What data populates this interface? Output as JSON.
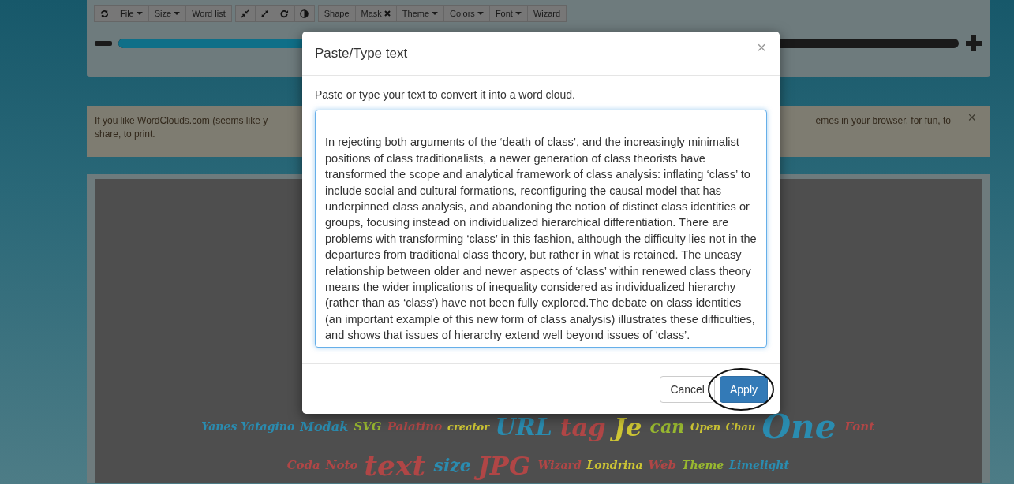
{
  "toolbar": {
    "groups": [
      [
        {
          "kind": "refresh"
        },
        {
          "kind": "dropdown",
          "label": "File"
        },
        {
          "kind": "dropdown",
          "label": "Size"
        },
        {
          "kind": "plain",
          "label": "Word list"
        }
      ],
      [
        {
          "kind": "shrink"
        },
        {
          "kind": "expand"
        },
        {
          "kind": "redo"
        },
        {
          "kind": "contrast"
        }
      ],
      [
        {
          "kind": "plain",
          "label": "Shape"
        },
        {
          "kind": "remove",
          "label": "Mask"
        },
        {
          "kind": "dropdown",
          "label": "Theme"
        },
        {
          "kind": "dropdown",
          "label": "Colors"
        },
        {
          "kind": "dropdown",
          "label": "Font"
        },
        {
          "kind": "plain",
          "label": "Wizard"
        }
      ]
    ],
    "zoom_slider": {
      "level": 0.5
    }
  },
  "banner": {
    "left_lines": [
      "If you like WordClouds.com (seems like y",
      "share, to print."
    ],
    "right_text": "emes in your browser, for fun, to",
    "close": "×"
  },
  "word_cloud": [
    {
      "text": "Yanes Yatagino",
      "color": "#2a8cb0"
    },
    {
      "text": "Modak",
      "color": "#2a8cb0"
    },
    {
      "text": "SVG",
      "color": "#98b830"
    },
    {
      "text": "Palatino",
      "color": "#b04646"
    },
    {
      "text": "creator",
      "color": "#cec634"
    },
    {
      "text": "URL",
      "color": "#2a8cb0"
    },
    {
      "text": "tag",
      "color": "#b04646"
    },
    {
      "text": "Je",
      "color": "#cec634"
    },
    {
      "text": "can",
      "color": "#98b830"
    },
    {
      "text": "Open",
      "color": "#cec634"
    },
    {
      "text": "Chau",
      "color": "#cec634"
    },
    {
      "text": "One",
      "color": "#2a8cb0"
    },
    {
      "text": "Font",
      "color": "#b04646"
    },
    {
      "text": "Coda",
      "color": "#b04646"
    },
    {
      "text": "Noto",
      "color": "#b04646"
    },
    {
      "text": "text",
      "color": "#b04646"
    },
    {
      "text": "size",
      "color": "#2a8cb0"
    },
    {
      "text": "JPG",
      "color": "#b04646"
    },
    {
      "text": "Wizard",
      "color": "#b04646"
    },
    {
      "text": "Londrina",
      "color": "#cec634"
    },
    {
      "text": "Web",
      "color": "#b04646"
    },
    {
      "text": "Theme",
      "color": "#98b830"
    },
    {
      "text": "Limelight",
      "color": "#2a8cb0"
    }
  ],
  "dialog": {
    "title": "Paste/Type text",
    "close": "×",
    "prompt": "Paste or type your text to convert it into a word cloud.",
    "text": "\nIn rejecting both arguments of the ‘death of class’, and the increasingly minimalist positions of class traditionalists, a newer generation of class theorists have transformed the scope and analytical framework of class analysis: inflating ‘class’ to include social and cultural formations, reconfiguring the causal model that has underpinned class analysis, and abandoning the notion of distinct class identities or groups, focusing instead on individualized hierarchical differentiation. There are problems with transforming ‘class’ in this fashion, although the difficulty lies not in the departures from traditional class theory, but rather in what is retained. The uneasy relationship between older and newer aspects of ‘class’ within renewed class theory means the wider implications of inequality considered as individualized hierarchy (rather than as ‘class’) have not been fully explored.The debate on class identities (an important example of this new form of class analysis) illustrates these difficulties, and shows that issues of hierarchy extend well beyond issues of ‘class’. ",
    "buttons": [
      {
        "kind": "default",
        "label": "Cancel"
      },
      {
        "kind": "primary",
        "label": "Apply",
        "circled": true
      }
    ]
  }
}
